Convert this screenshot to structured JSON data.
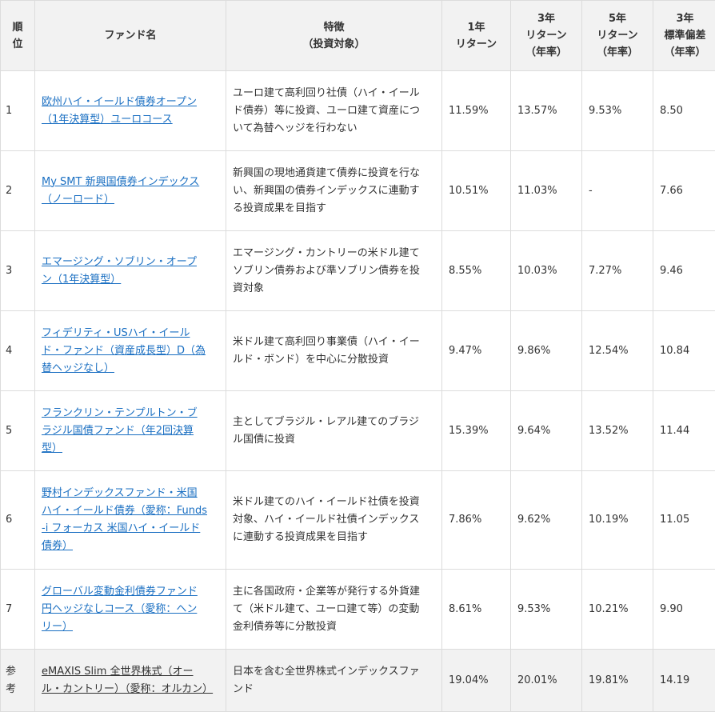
{
  "headers": {
    "rank": "順\n位",
    "fund": "ファンド名",
    "feature": "特徴\n（投資対象）",
    "ret1": "1年\nリターン",
    "ret3": "3年\nリターン\n（年率）",
    "ret5": "5年\nリターン\n（年率）",
    "sd3": "3年\n標準偏差\n（年率）"
  },
  "rows": [
    {
      "rank": "1",
      "name": "欧州ハイ・イールド債券オープン\n（1年決算型）ユーロコース",
      "feature": "ユーロ建て高利回り社債（ハイ・イール\nド債券）等に投資、ユーロ建て資産につ\nいて為替ヘッジを行わない",
      "r1": "11.59%",
      "r3": "13.57%",
      "r5": "9.53%",
      "sd": "8.50"
    },
    {
      "rank": "2",
      "name": "My SMT 新興国債券インデックス\n（ノーロード）",
      "feature": "新興国の現地通貨建て債券に投資を行な\nい、新興国の債券インデックスに連動す\nる投資成果を目指す",
      "r1": "10.51%",
      "r3": "11.03%",
      "r5": "-",
      "sd": "7.66"
    },
    {
      "rank": "3",
      "name": "エマージング・ソブリン・オープ\nン（1年決算型）",
      "feature": "エマージング・カントリーの米ドル建て\nソブリン債券および準ソブリン債券を投\n資対象",
      "r1": "8.55%",
      "r3": "10.03%",
      "r5": "7.27%",
      "sd": "9.46"
    },
    {
      "rank": "4",
      "name": "フィデリティ・USハイ・イール\nド・ファンド（資産成長型）D（為\n替ヘッジなし）",
      "feature": "米ドル建て高利回り事業債（ハイ・イー\nルド・ボンド）を中心に分散投資",
      "r1": "9.47%",
      "r3": "9.86%",
      "r5": "12.54%",
      "sd": "10.84"
    },
    {
      "rank": "5",
      "name": "フランクリン・テンプルトン・ブ\nラジル国債ファンド（年2回決算\n型）",
      "feature": "主としてブラジル・レアル建てのブラジ\nル国債に投資",
      "r1": "15.39%",
      "r3": "9.64%",
      "r5": "13.52%",
      "sd": "11.44"
    },
    {
      "rank": "6",
      "name": "野村インデックスファンド・米国\nハイ・イールド債券（愛称：Funds\n-i フォーカス 米国ハイ・イールド\n債券）",
      "feature": "米ドル建てのハイ・イールド社債を投資\n対象、ハイ・イールド社債インデックス\nに連動する投資成果を目指す",
      "r1": "7.86%",
      "r3": "9.62%",
      "r5": "10.19%",
      "sd": "11.05"
    },
    {
      "rank": "7",
      "name": "グローバル変動金利債券ファンド\n円ヘッジなしコース（愛称：ヘン\nリー）",
      "feature": "主に各国政府・企業等が発行する外貨建\nて（米ドル建て、ユーロ建て等）の変動\n金利債券等に分散投資",
      "r1": "8.61%",
      "r3": "9.53%",
      "r5": "10.21%",
      "sd": "9.90"
    }
  ],
  "ref_row": {
    "rank": "参\n考",
    "name": "eMAXIS Slim 全世界株式（オー\nル・カントリー）（愛称：オルカン）",
    "feature": "日本を含む全世界株式インデックスファ\nンド",
    "r1": "19.04%",
    "r3": "20.01%",
    "r5": "19.81%",
    "sd": "14.19"
  },
  "colors": {
    "link": "#1a6fc2",
    "header_bg": "#f2f2f2",
    "border": "#dcdcdc"
  }
}
